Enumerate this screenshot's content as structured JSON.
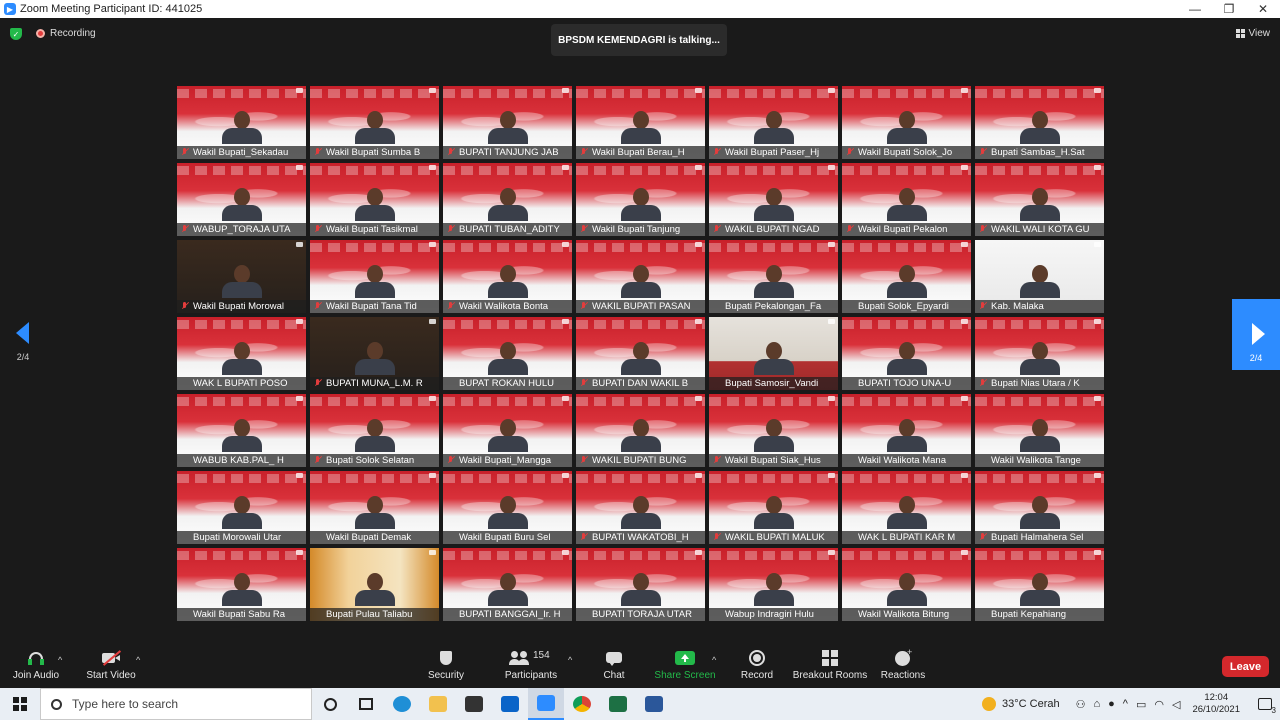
{
  "window": {
    "title": "Zoom Meeting Participant ID: 441025",
    "minimize": "—",
    "maximize": "❐",
    "close": "✕"
  },
  "meeting": {
    "recording_label": "Recording",
    "talking_banner": "BPSDM KEMENDAGRI is talking...",
    "view_label": "View",
    "page_left_label": "2/4",
    "page_right_label": "2/4"
  },
  "tiles": [
    {
      "name": "Wakil Bupati_Sekadau",
      "style": "red",
      "muted": true
    },
    {
      "name": "Wakil Bupati Sumba B",
      "style": "red",
      "muted": true
    },
    {
      "name": "BUPATI TANJUNG JAB",
      "style": "red",
      "muted": true
    },
    {
      "name": "Wakil Bupati Berau_H",
      "style": "red",
      "muted": true
    },
    {
      "name": "Wakil Bupati Paser_Hj",
      "style": "red",
      "muted": true
    },
    {
      "name": "Wakil Bupati Solok_Jo",
      "style": "red",
      "muted": true
    },
    {
      "name": "Bupati Sambas_H.Sat",
      "style": "red",
      "muted": true
    },
    {
      "name": "WABUP_TORAJA UTA",
      "style": "red",
      "muted": true
    },
    {
      "name": "Wakil Bupati Tasikmal",
      "style": "red",
      "muted": true
    },
    {
      "name": "BUPATI TUBAN_ADITY",
      "style": "red",
      "muted": true
    },
    {
      "name": "Wakil Bupati Tanjung",
      "style": "red",
      "muted": true
    },
    {
      "name": "WAKIL BUPATI NGAD",
      "style": "red",
      "muted": true
    },
    {
      "name": "Wakil Bupati Pekalon",
      "style": "red",
      "muted": true
    },
    {
      "name": "WAKIL WALI KOTA GU",
      "style": "red",
      "muted": true
    },
    {
      "name": "Wakil Bupati Morowal",
      "style": "dark",
      "muted": true
    },
    {
      "name": "Wakil Bupati Tana Tid",
      "style": "red",
      "muted": true
    },
    {
      "name": "Wakil Walikota Bonta",
      "style": "red",
      "muted": true
    },
    {
      "name": "WAKIL BUPATI PASAN",
      "style": "red",
      "muted": true
    },
    {
      "name": "Bupati Pekalongan_Fa",
      "style": "red",
      "muted": false
    },
    {
      "name": "Bupati Solok_Epyardi",
      "style": "red",
      "muted": false
    },
    {
      "name": "Kab. Malaka",
      "style": "white",
      "muted": true
    },
    {
      "name": "WAK L BUPATI POSO",
      "style": "red",
      "muted": false
    },
    {
      "name": "BUPATI MUNA_L.M. R",
      "style": "dark",
      "muted": true
    },
    {
      "name": "BUPAT ROKAN HULU",
      "style": "red",
      "muted": false
    },
    {
      "name": "BUPATI DAN WAKIL B",
      "style": "red",
      "muted": true
    },
    {
      "name": "Bupati Samosir_Vandi",
      "style": "room",
      "muted": false
    },
    {
      "name": "BUPATI TOJO UNA-U",
      "style": "red",
      "muted": false
    },
    {
      "name": "Bupati Nias Utara / K",
      "style": "red",
      "muted": true
    },
    {
      "name": "WABUB KAB.PAL_ H",
      "style": "red",
      "muted": false
    },
    {
      "name": "Bupati Solok Selatan",
      "style": "red",
      "muted": true
    },
    {
      "name": "Wakil Bupati_Mangga",
      "style": "red",
      "muted": true
    },
    {
      "name": "WAKIL BUPATI BUNG",
      "style": "red",
      "muted": true
    },
    {
      "name": "Wakil Bupati Siak_Hus",
      "style": "red",
      "muted": true
    },
    {
      "name": "Wakil Walikota Mana",
      "style": "red",
      "muted": false
    },
    {
      "name": "Wakil Walikota Tange",
      "style": "red",
      "muted": false
    },
    {
      "name": "Bupati Morowali Utar",
      "style": "red",
      "muted": false
    },
    {
      "name": "Wakil Bupati Demak",
      "style": "red",
      "muted": false
    },
    {
      "name": "Wakil Bupati Buru Sel",
      "style": "red",
      "muted": false
    },
    {
      "name": "BUPATI WAKATOBI_H",
      "style": "red",
      "muted": true
    },
    {
      "name": "WAKIL BUPATI MALUK",
      "style": "red",
      "muted": true
    },
    {
      "name": "WAK L BUPATI KAR M",
      "style": "red",
      "muted": false
    },
    {
      "name": "Bupati Halmahera Sel",
      "style": "red",
      "muted": true
    },
    {
      "name": "Wakil Bupati Sabu Ra",
      "style": "red",
      "muted": false
    },
    {
      "name": "Bupati Pulau Taliabu",
      "style": "orange",
      "muted": false
    },
    {
      "name": "BUPATI BANGGAI_Ir. H",
      "style": "red",
      "muted": false
    },
    {
      "name": "BUPATI TORAJA UTAR",
      "style": "red",
      "muted": false
    },
    {
      "name": "Wabup Indragiri Hulu",
      "style": "red",
      "muted": false
    },
    {
      "name": "Wakil Walikota Bitung",
      "style": "red",
      "muted": false
    },
    {
      "name": "Bupati Kepahiang",
      "style": "red",
      "muted": false
    }
  ],
  "toolbar": {
    "join_audio": "Join Audio",
    "start_video": "Start Video",
    "security": "Security",
    "participants": "Participants",
    "participants_count": "154",
    "chat": "Chat",
    "share_screen": "Share Screen",
    "record": "Record",
    "breakout_rooms": "Breakout Rooms",
    "reactions": "Reactions",
    "leave": "Leave",
    "caret": "^"
  },
  "taskbar": {
    "search_placeholder": "Type here to search",
    "weather": "33°C  Cerah",
    "time": "12:04",
    "date": "26/10/2021",
    "notif_count": "3"
  },
  "colors": {
    "zoom_blue": "#2d8cff",
    "leave_red": "#d4282c",
    "share_green": "#23b94a"
  }
}
